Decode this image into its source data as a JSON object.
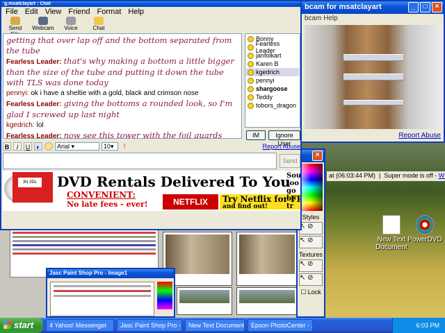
{
  "chat": {
    "title": "g.msatclayart : Chat",
    "menu": [
      "File",
      "Edit",
      "View",
      "Friend",
      "Format",
      "Help"
    ],
    "toolbar": [
      "Send File",
      "Webcam",
      "Voice",
      "Chat"
    ],
    "messages": [
      {
        "sender": "",
        "text": "getting that over lap off and the bottom separated from the tube",
        "style": "script"
      },
      {
        "sender": "Fearless Leader:",
        "text": "that's why making a bottom a little bigger than the size of the tube and putting it down the tube with TLS was done today",
        "style": "script"
      },
      {
        "sender": "pennyi:",
        "text": "ok i have a sheltie with a gold, black and crimson nose",
        "style": "plain"
      },
      {
        "sender": "Fearless Leader:",
        "text": "giving the bottoms a rounded look, so I'm glad I screwed up last night",
        "style": "script"
      },
      {
        "sender": "kgedrich:",
        "text": "lol",
        "style": "plain"
      },
      {
        "sender": "Fearless Leader:",
        "text": "now see this tower with the foil guards where they touch the next section down?",
        "style": "script"
      }
    ],
    "users": [
      "Bonny",
      "Fearless Leader",
      "janfolkart",
      "Karen B",
      "kgedrich",
      "pennyi",
      "shargoose",
      "Teddy",
      "tobors_dragon"
    ],
    "selected_user": "kgedrich",
    "bold_user": "shargoose",
    "im_label": "IM",
    "ignore_label": "Ignore User",
    "format": {
      "bold": "B",
      "italic": "I",
      "underline": "U",
      "font": "Arial",
      "size": "10"
    },
    "report_abuse": "Report Abuse",
    "input_value": "",
    "send_label": "Send"
  },
  "ad": {
    "tape_label": "3N 3DL",
    "headline": "DVD Rentals Delivered To You",
    "convenient": "CONVENIENT:",
    "no_late": "No late fees - ever!",
    "netflix": "NETFLIX",
    "try_line1": "Try Netflix for FRE",
    "try_line2": "and find out!",
    "side": [
      "Sou",
      "too go",
      "be tr"
    ]
  },
  "webcam": {
    "title": "bcam for msatclayart",
    "menu": "bcam   Help",
    "report_abuse": "Report Abuse"
  },
  "info_strip": {
    "time": "at (06:03:44 PM)",
    "mode": "Super mode is off -",
    "link": "What's this?"
  },
  "palette": {
    "styles": "Styles",
    "textures": "Textures",
    "lock": "Lock"
  },
  "desktop_icons": [
    "New Text Document",
    "PowerDVD"
  ],
  "taskbar": {
    "start": "start",
    "tasks": [
      "4 Yahoo! Messenger",
      "Jasc Paint Shop Pro - ...",
      "New Text Document -...",
      "Epson PhotoCenter - ..."
    ],
    "clock": "6:03 PM"
  },
  "psp_small": {
    "title": "Jasc Paint Shop Pro - Image1"
  }
}
